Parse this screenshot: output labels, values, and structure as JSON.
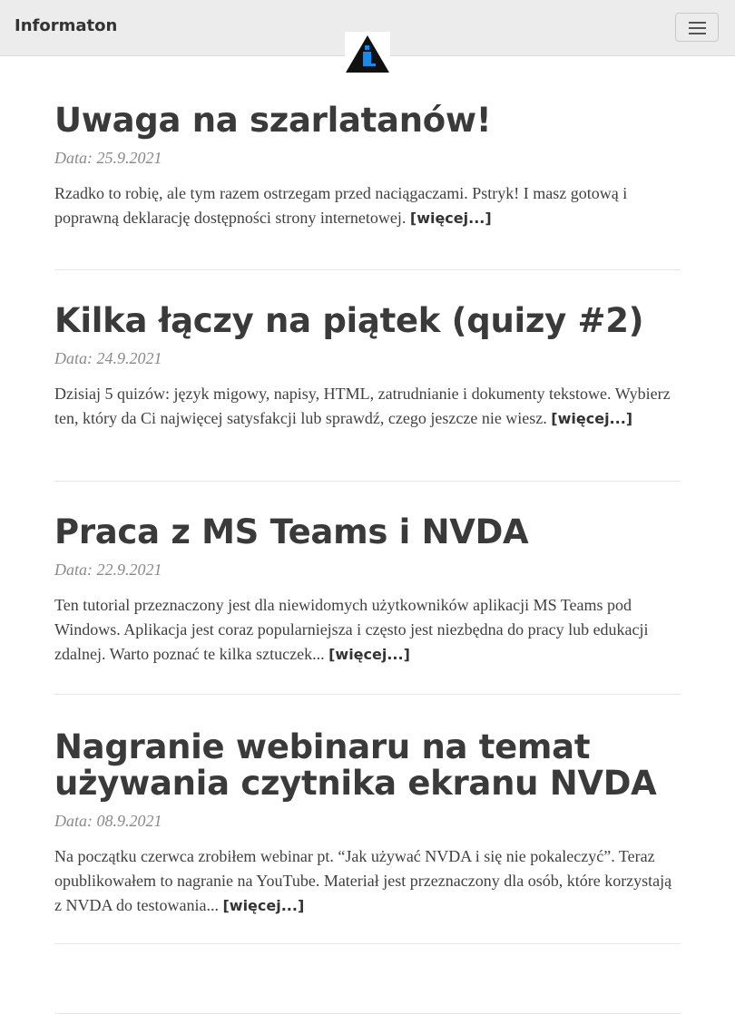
{
  "nav": {
    "brand": "Informaton",
    "menu_icon": "hamburger-menu-icon",
    "logo_icon": "info-triangle-logo",
    "logo_letter": "i",
    "logo_colors": {
      "triangle": "#111111",
      "letter": "#1e88e5"
    }
  },
  "posts": [
    {
      "title": "Uwaga na szarlatanów!",
      "date": "Data: 25.9.2021",
      "excerpt": "Rzadko to robię, ale tym razem ostrzegam przed naciągaczami. Pstryk! I masz gotową i poprawną deklarację dostępności strony internetowej.",
      "more": "[więcej...]"
    },
    {
      "title": "Kilka łączy na piątek (quizy #2)",
      "date": "Data: 24.9.2021",
      "excerpt": "Dzisiaj 5 quizów: język migowy, napisy, HTML, zatrudnianie i dokumenty tekstowe. Wybierz ten, który da Ci najwięcej satysfakcji lub sprawdź, czego jeszcze nie wiesz.",
      "more": "[więcej...]"
    },
    {
      "title": "Praca z MS Teams i NVDA",
      "date": "Data: 22.9.2021",
      "excerpt": "Ten tutorial przeznaczony jest dla niewidomych użytkowników aplikacji MS Teams pod Windows. Aplikacja jest coraz popularniejsza i często jest niezbędna do pracy lub edukacji zdalnej. Warto poznać te kilka sztuczek...",
      "more": "[więcej...]"
    },
    {
      "title": "Nagranie webinaru na temat używania czytnika ekranu NVDA",
      "date": "Data: 08.9.2021",
      "excerpt": "Na początku czerwca zrobiłem webinar pt. “Jak używać NVDA i się nie pokaleczyć”. Teraz opublikowałem to nagranie na YouTube. Materiał jest przeznaczony dla osób, które korzystają z NVDA do testowania...",
      "more": "[więcej...]"
    }
  ]
}
